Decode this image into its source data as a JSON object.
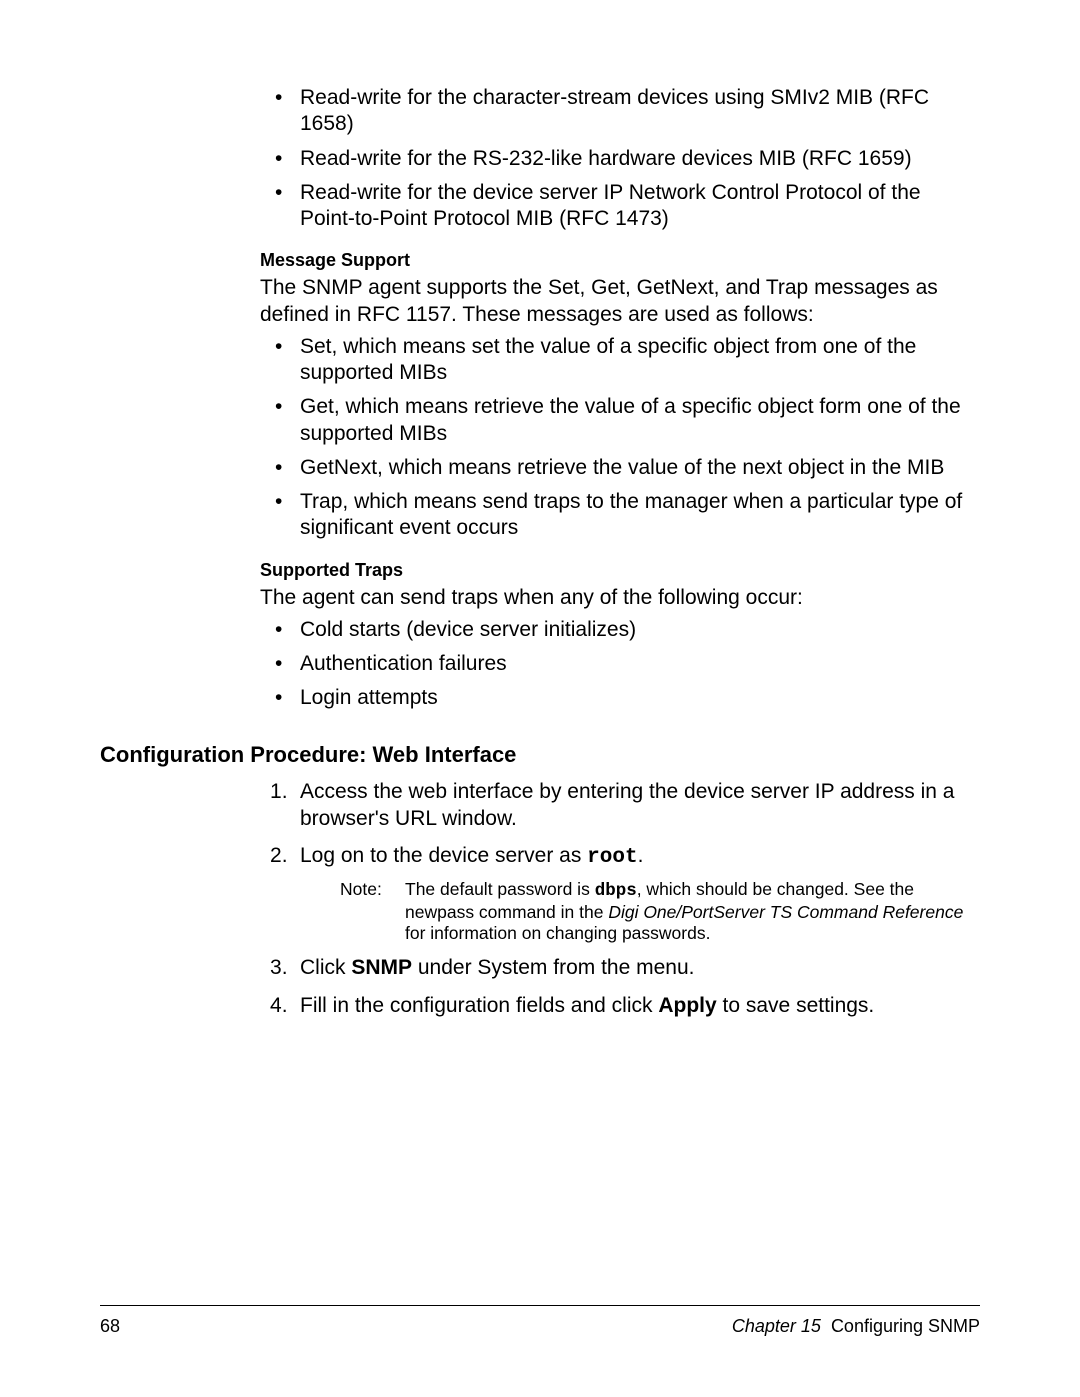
{
  "topBullets": [
    "Read-write for the character-stream devices using SMIv2 MIB (RFC 1658)",
    "Read-write for the RS-232-like hardware devices MIB (RFC 1659)",
    "Read-write for the device server IP Network Control Protocol of the Point-to-Point Protocol MIB (RFC 1473)"
  ],
  "messageSupport": {
    "heading": "Message Support",
    "intro": "The SNMP agent supports the Set, Get, GetNext, and Trap messages as defined in RFC 1157. These messages are used as follows:",
    "bullets": [
      "Set, which means set the value of a specific object from one of the supported MIBs",
      "Get, which means retrieve the value of a specific object form one of the supported MIBs",
      "GetNext, which means retrieve the value of the next object in the MIB",
      "Trap, which means send traps to the manager when a particular type of significant event occurs"
    ]
  },
  "supportedTraps": {
    "heading": "Supported Traps",
    "intro": "The agent can send traps when any of the following occur:",
    "bullets": [
      "Cold starts (device server initializes)",
      "Authentication failures",
      "Login attempts"
    ]
  },
  "configProcedure": {
    "heading": "Configuration Procedure: Web Interface",
    "step1": "Access the web interface by entering the device server IP address in a browser's URL window.",
    "step2_pre": "Log on to the device server as ",
    "step2_mono": "root",
    "step2_post": ".",
    "note": {
      "label": "Note:",
      "pre": "The default password is ",
      "mono": "dbps",
      "mid": ", which should be changed. See the newpass command in the ",
      "italic": "Digi One/PortServer TS Command Reference",
      "post": " for information on changing passwords."
    },
    "step3_pre": "Click ",
    "step3_bold": "SNMP",
    "step3_post": " under System from the menu.",
    "step4_pre": "Fill in the configuration fields and click ",
    "step4_bold": "Apply",
    "step4_post": " to save settings."
  },
  "footer": {
    "pageNum": "68",
    "chapterItalic": "Chapter 15",
    "chapterTitle": "Configuring SNMP"
  }
}
